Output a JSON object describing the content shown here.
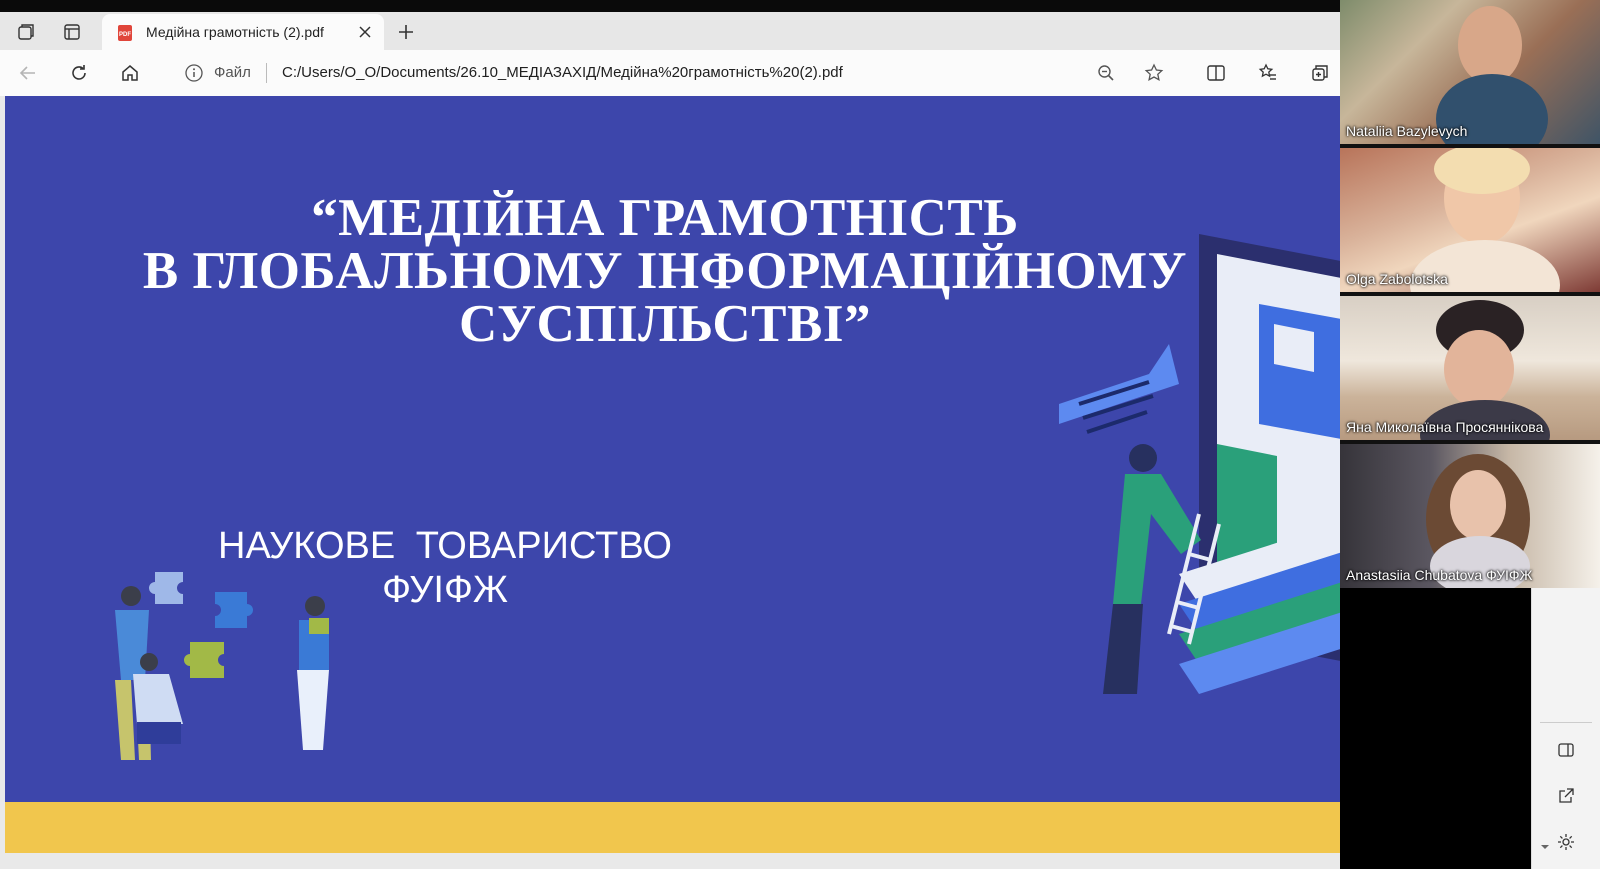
{
  "browser": {
    "tab_title": "Медійна грамотність (2).pdf",
    "file_label": "Файл",
    "url": "C:/Users/O_O/Documents/26.10_МЕДІАЗАХІД/Медійна%20грамотність%20(2).pdf"
  },
  "slide": {
    "title_line1": "“МЕДІЙНА ГРАМОТНІСТЬ",
    "title_line2": "В  ГЛОБАЛЬНОМУ  ІНФОРМАЦІЙНОМУ",
    "title_line3": "СУСПІЛЬСТВІ”",
    "subtitle_line1": "НАУКОВЕ  ТОВАРИСТВО",
    "subtitle_line2": "ФУІФЖ",
    "background_color": "#3d46ab",
    "accent_bar_color": "#f1c64d"
  },
  "participants": [
    {
      "name": "Nataliia Bazylevych"
    },
    {
      "name": "Olga Zabolotska"
    },
    {
      "name": "Яна Миколаївна Просяннікова"
    },
    {
      "name": "Anastasiia Chubatova ФУІФЖ"
    }
  ],
  "icons": {
    "toolbar": [
      "collections-icon",
      "tab-actions-icon",
      "pdf-icon",
      "close-icon",
      "plus-icon",
      "back-icon",
      "refresh-icon",
      "home-icon",
      "info-icon",
      "zoom-out-icon",
      "star-icon",
      "split-screen-icon",
      "favorites-icon",
      "collections-add-icon"
    ],
    "sidebar": [
      "sidebar-toggle-icon",
      "open-external-icon",
      "settings-icon"
    ]
  }
}
